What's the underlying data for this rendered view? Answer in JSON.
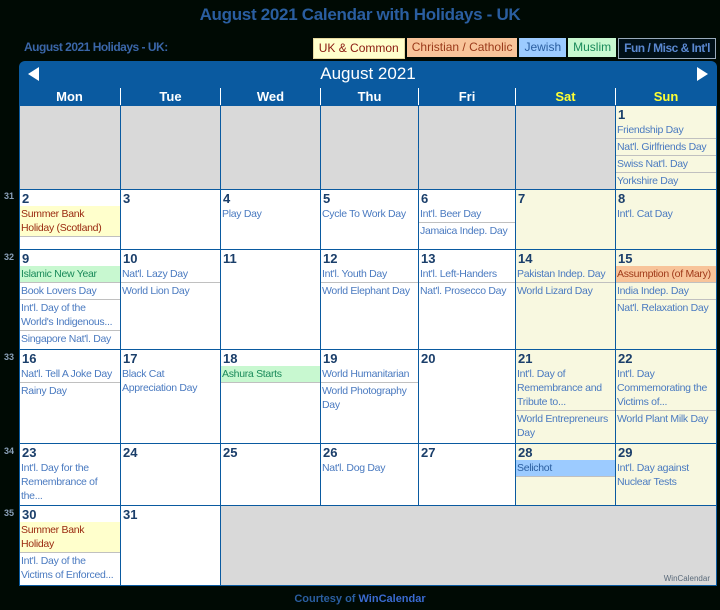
{
  "page": {
    "title": "August 2021 Calendar with Holidays - UK",
    "subtitle": "August 2021 Holidays - UK:"
  },
  "legend": [
    {
      "label": "UK & Common",
      "type": "uk"
    },
    {
      "label": "Christian / Catholic",
      "type": "chr"
    },
    {
      "label": "Jewish",
      "type": "jew"
    },
    {
      "label": "Muslim",
      "type": "mus"
    },
    {
      "label": "Fun / Misc & Int'l",
      "type": "fun"
    }
  ],
  "calendar": {
    "month_label": "August 2021",
    "prev_icon": "triangle-left-icon",
    "next_icon": "triangle-right-icon",
    "weekdays": [
      "Mon",
      "Tue",
      "Wed",
      "Thu",
      "Fri",
      "Sat",
      "Sun"
    ],
    "weekend_color": "#ffff33",
    "header_color": "#0a5aa0",
    "week_numbers": [
      "31",
      "32",
      "33",
      "34",
      "35"
    ],
    "days": {
      "1": {
        "events": [
          {
            "t": "Friendship Day",
            "c": "fun"
          },
          {
            "t": "Nat'l. Girlfriends Day",
            "c": "fun"
          },
          {
            "t": "Swiss Nat'l. Day",
            "c": "fun"
          },
          {
            "t": "Yorkshire Day",
            "c": "fun"
          }
        ]
      },
      "2": {
        "events": [
          {
            "t": "Summer Bank Holiday (Scotland)",
            "c": "uk"
          }
        ]
      },
      "3": {
        "events": []
      },
      "4": {
        "events": [
          {
            "t": "Play Day",
            "c": "fun"
          }
        ]
      },
      "5": {
        "events": [
          {
            "t": "Cycle To Work Day",
            "c": "fun"
          }
        ]
      },
      "6": {
        "events": [
          {
            "t": "Int'l. Beer Day",
            "c": "fun"
          },
          {
            "t": "Jamaica Indep. Day",
            "c": "fun"
          }
        ]
      },
      "7": {
        "events": []
      },
      "8": {
        "events": [
          {
            "t": "Int'l. Cat Day",
            "c": "fun"
          }
        ]
      },
      "9": {
        "events": [
          {
            "t": "Islamic New Year",
            "c": "mus"
          },
          {
            "t": "Book Lovers Day",
            "c": "fun"
          },
          {
            "t": "Int'l. Day of the World's Indigenous...",
            "c": "fun"
          },
          {
            "t": "Singapore Nat'l. Day",
            "c": "fun"
          }
        ]
      },
      "10": {
        "events": [
          {
            "t": "Nat'l. Lazy Day",
            "c": "fun"
          },
          {
            "t": "World Lion Day",
            "c": "fun"
          }
        ]
      },
      "11": {
        "events": []
      },
      "12": {
        "events": [
          {
            "t": "Int'l. Youth Day",
            "c": "fun"
          },
          {
            "t": "World Elephant Day",
            "c": "fun"
          }
        ]
      },
      "13": {
        "events": [
          {
            "t": "Int'l. Left-Handers",
            "c": "fun"
          },
          {
            "t": "Nat'l. Prosecco Day",
            "c": "fun"
          }
        ]
      },
      "14": {
        "events": [
          {
            "t": "Pakistan Indep. Day",
            "c": "fun"
          },
          {
            "t": "World Lizard Day",
            "c": "fun"
          }
        ]
      },
      "15": {
        "events": [
          {
            "t": "Assumption (of Mary)",
            "c": "chr"
          },
          {
            "t": "India Indep. Day",
            "c": "fun"
          },
          {
            "t": "Nat'l. Relaxation Day",
            "c": "fun"
          }
        ]
      },
      "16": {
        "events": [
          {
            "t": "Nat'l. Tell A Joke Day",
            "c": "fun"
          },
          {
            "t": "Rainy Day",
            "c": "fun"
          }
        ]
      },
      "17": {
        "events": [
          {
            "t": "Black Cat Appreciation Day",
            "c": "fun"
          }
        ]
      },
      "18": {
        "events": [
          {
            "t": "Ashura Starts",
            "c": "mus"
          }
        ]
      },
      "19": {
        "events": [
          {
            "t": "World Humanitarian",
            "c": "fun"
          },
          {
            "t": "World Photography Day",
            "c": "fun"
          }
        ]
      },
      "20": {
        "events": []
      },
      "21": {
        "events": [
          {
            "t": "Int'l. Day of Remembrance and Tribute to...",
            "c": "fun"
          },
          {
            "t": "World Entrepreneurs Day",
            "c": "fun"
          }
        ]
      },
      "22": {
        "events": [
          {
            "t": "Int'l. Day Commemorating the Victims of...",
            "c": "fun"
          },
          {
            "t": "World Plant Milk Day",
            "c": "fun"
          }
        ]
      },
      "23": {
        "events": [
          {
            "t": "Int'l. Day for the Remembrance of the...",
            "c": "fun"
          }
        ]
      },
      "24": {
        "events": []
      },
      "25": {
        "events": []
      },
      "26": {
        "events": [
          {
            "t": "Nat'l. Dog Day",
            "c": "fun"
          }
        ]
      },
      "27": {
        "events": []
      },
      "28": {
        "events": [
          {
            "t": "Selichot",
            "c": "jew"
          }
        ]
      },
      "29": {
        "events": [
          {
            "t": "Int'l. Day against Nuclear Tests",
            "c": "fun"
          }
        ]
      },
      "30": {
        "events": [
          {
            "t": "Summer Bank Holiday",
            "c": "uk"
          },
          {
            "t": "Int'l. Day of the Victims of Enforced...",
            "c": "fun"
          }
        ]
      },
      "31": {
        "events": []
      }
    },
    "watermark": "WinCalendar"
  },
  "footer": {
    "prefix": "Courtesy of",
    "link": "WinCalendar"
  }
}
